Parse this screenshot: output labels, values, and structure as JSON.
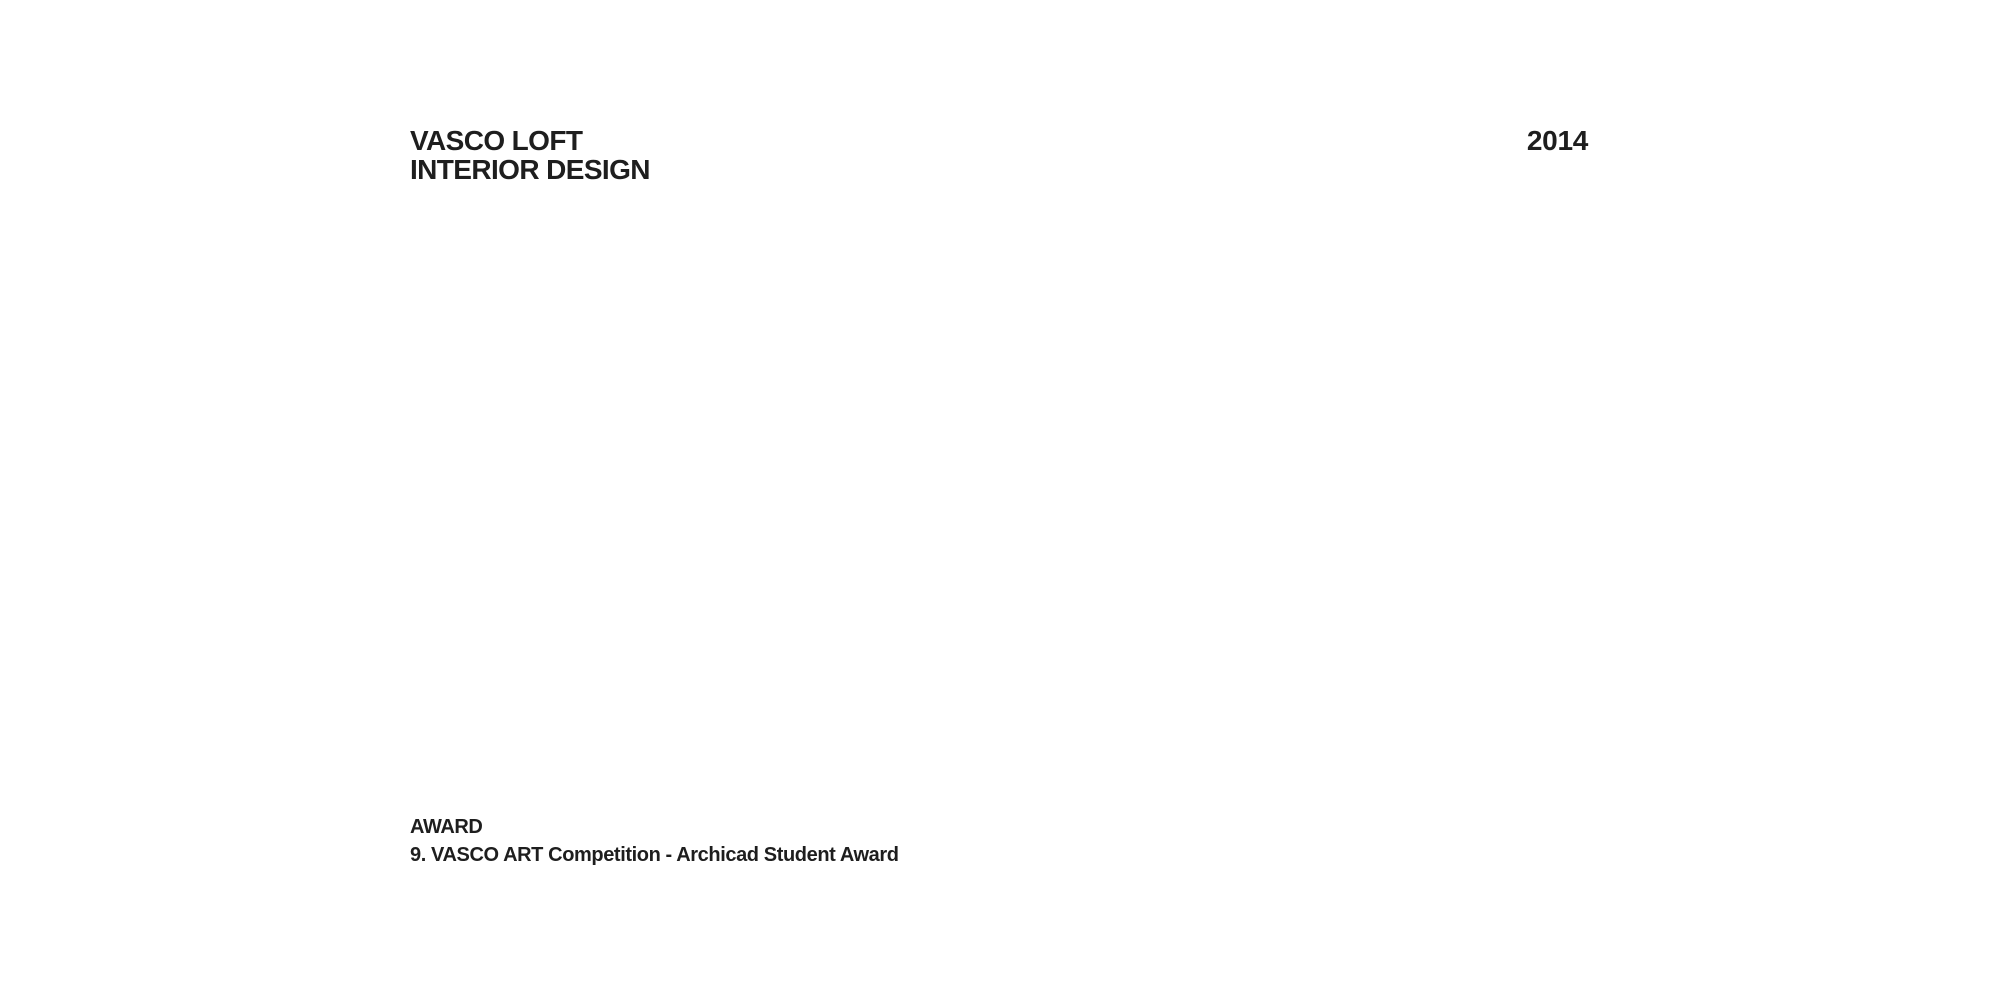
{
  "project": {
    "title_line1": "VASCO LOFT",
    "title_line2": "INTERIOR DESIGN",
    "year": "2014"
  },
  "award": {
    "label": "AWARD",
    "text": "9. VASCO ART Competition - Archicad Student Award"
  }
}
